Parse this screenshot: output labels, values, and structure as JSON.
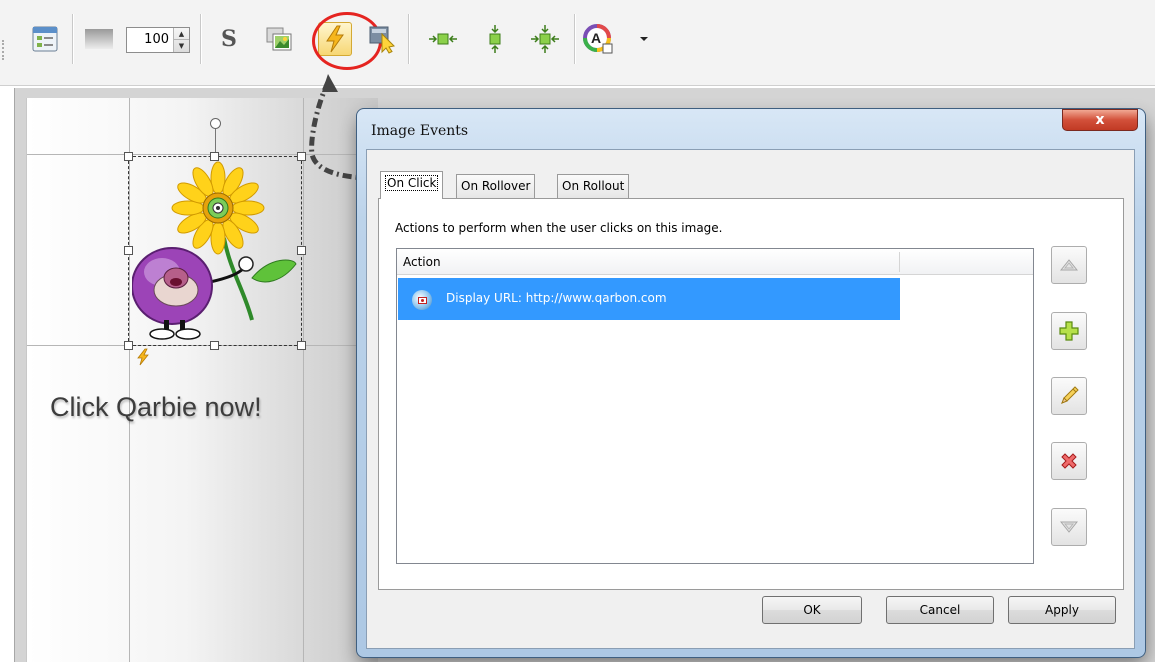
{
  "toolbar": {
    "zoom_value": "100",
    "style_letter": "S",
    "buttons": [
      "properties-icon",
      "opacity-icon",
      "style-s-icon",
      "image-icon",
      "events-lightning-icon",
      "select-cursor-icon",
      "center-horizontal-icon",
      "center-vertical-icon",
      "center-both-icon",
      "color-palette-icon",
      "dropdown-arrow-icon"
    ]
  },
  "canvas": {
    "caption": "Click Qarbie now!"
  },
  "dialog": {
    "title": "Image Events",
    "close_label": "x",
    "tabs": [
      {
        "label": "On Click",
        "active": true
      },
      {
        "label": "On Rollover",
        "active": false
      },
      {
        "label": "On Rollout",
        "active": false
      }
    ],
    "description": "Actions to perform when the user clicks on this image.",
    "column_header": "Action",
    "actions": [
      {
        "label": "Display URL: http://www.qarbon.com",
        "selected": true,
        "icon": "url-icon"
      }
    ],
    "side_buttons": [
      "move-up-icon",
      "add-icon",
      "edit-icon",
      "delete-icon",
      "move-down-icon"
    ],
    "ok_label": "OK",
    "cancel_label": "Cancel",
    "apply_label": "Apply"
  },
  "colors": {
    "highlight_circle": "#e52420",
    "selection": "#3399ff",
    "close_button": "#c94a33"
  }
}
